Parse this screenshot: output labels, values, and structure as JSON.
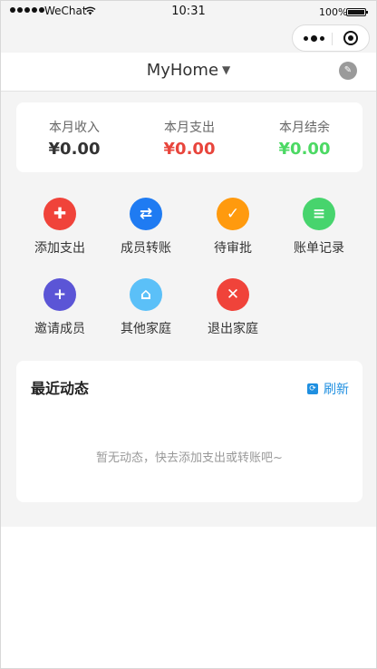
{
  "status_bar": {
    "carrier": "WeChat",
    "time": "10:31",
    "battery": "100%"
  },
  "nav": {
    "title": "MyHome",
    "caret": "▼",
    "edit_icon": "✎"
  },
  "summary": [
    {
      "label": "本月收入",
      "value": "¥0.00",
      "color": "#333333"
    },
    {
      "label": "本月支出",
      "value": "¥0.00",
      "color": "#e8453c"
    },
    {
      "label": "本月结余",
      "value": "¥0.00",
      "color": "#4cd964"
    }
  ],
  "actions": [
    {
      "label": "添加支出",
      "icon": "add-expense-icon",
      "glyph": "✚",
      "color": "#f0433a"
    },
    {
      "label": "成员转账",
      "icon": "transfer-icon",
      "glyph": "⇄",
      "color": "#1f7bf2"
    },
    {
      "label": "待审批",
      "icon": "pending-approval-icon",
      "glyph": "✓",
      "color": "#ff9a0e"
    },
    {
      "label": "账单记录",
      "icon": "bill-records-icon",
      "glyph": "≡",
      "color": "#47d46d"
    },
    {
      "label": "邀请成员",
      "icon": "invite-member-icon",
      "glyph": "+",
      "color": "#5b55d6"
    },
    {
      "label": "其他家庭",
      "icon": "other-family-icon",
      "glyph": "⌂",
      "color": "#5bc0f8"
    },
    {
      "label": "退出家庭",
      "icon": "exit-family-icon",
      "glyph": "✕",
      "color": "#f0433a"
    }
  ],
  "recent": {
    "title": "最近动态",
    "refresh_label": "刷新",
    "refresh_glyph": "⟳",
    "empty_text": "暂无动态，快去添加支出或转账吧~"
  }
}
